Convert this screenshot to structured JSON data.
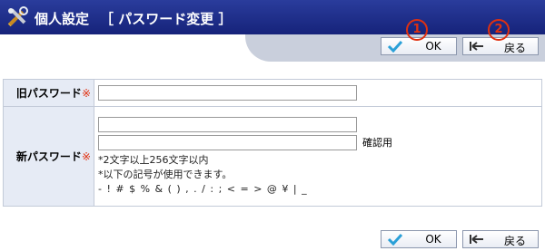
{
  "header": {
    "title": "個人設定",
    "subtitle": "［ パスワード変更 ］"
  },
  "toolbar": {
    "ok_label": "OK",
    "back_label": "戻る",
    "badge_1": "1",
    "badge_2": "2"
  },
  "form": {
    "old_password": {
      "label": "旧パスワード",
      "required_mark": "※",
      "value": ""
    },
    "new_password": {
      "label": "新パスワード",
      "required_mark": "※",
      "value": "",
      "confirm_value": "",
      "confirm_label": "確認用",
      "hint_length": "*2文字以上256文字以内",
      "hint_symbols": "*以下の記号が使用できます。",
      "symbols": "- ! # $ % & ( ) , . / : ; < = > @ ¥ | _"
    }
  },
  "bottom_toolbar": {
    "ok_label": "OK",
    "back_label": "戻る"
  },
  "colors": {
    "header_bg": "#1e2d8a",
    "band_bg": "#c9cfdc",
    "label_bg": "#e6ebf5",
    "required": "#e03010",
    "ok_check": "#2aa0d8"
  }
}
